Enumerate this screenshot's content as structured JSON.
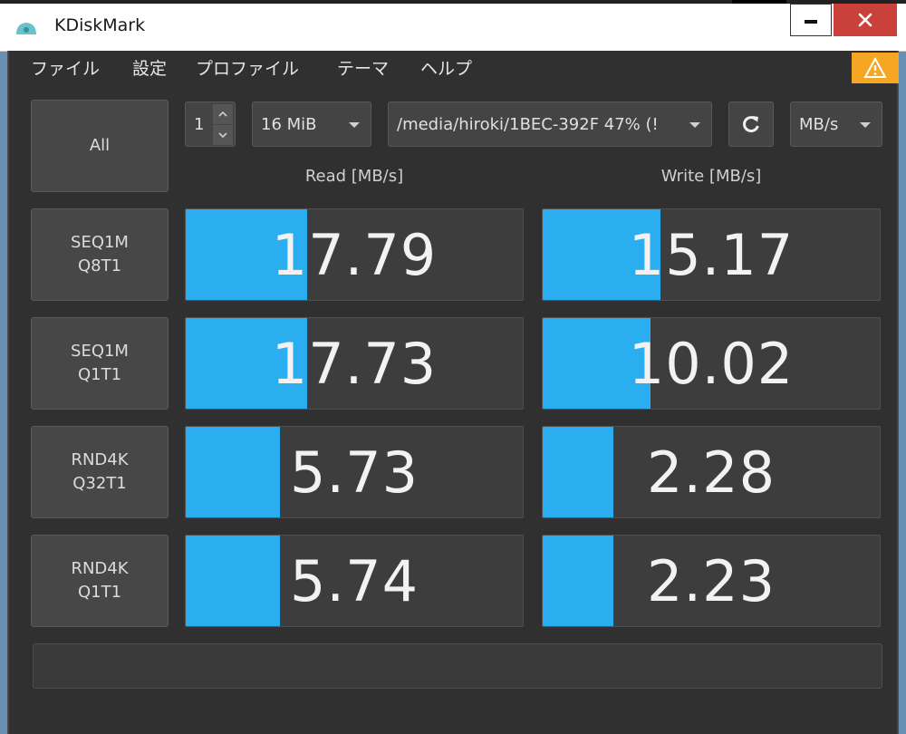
{
  "window": {
    "title": "KDiskMark"
  },
  "menu": [
    "ファイル",
    "設定",
    "プロファイル",
    "テーマ",
    "ヘルプ"
  ],
  "controls": {
    "all_label": "All",
    "loops": "1",
    "size": "16 MiB",
    "device": "/media/hiroki/1BEC-392F 47% (!",
    "unit": "MB/s"
  },
  "headers": {
    "read": "Read [MB/s]",
    "write": "Write [MB/s]"
  },
  "tests": [
    {
      "line1": "SEQ1M",
      "line2": "Q8T1",
      "read": "17.79",
      "write": "15.17",
      "read_fill": 0.36,
      "write_fill": 0.35
    },
    {
      "line1": "SEQ1M",
      "line2": "Q1T1",
      "read": "17.73",
      "write": "10.02",
      "read_fill": 0.36,
      "write_fill": 0.32
    },
    {
      "line1": "RND4K",
      "line2": "Q32T1",
      "read": "5.73",
      "write": "2.28",
      "read_fill": 0.28,
      "write_fill": 0.21
    },
    {
      "line1": "RND4K",
      "line2": "Q1T1",
      "read": "5.74",
      "write": "2.23",
      "read_fill": 0.28,
      "write_fill": 0.21
    }
  ],
  "icons": {
    "app": "disk-icon",
    "refresh": "refresh-icon",
    "warning": "warning-icon"
  },
  "colors": {
    "accent": "#2aaef0",
    "warning": "#f5a623",
    "close": "#c9413a"
  }
}
